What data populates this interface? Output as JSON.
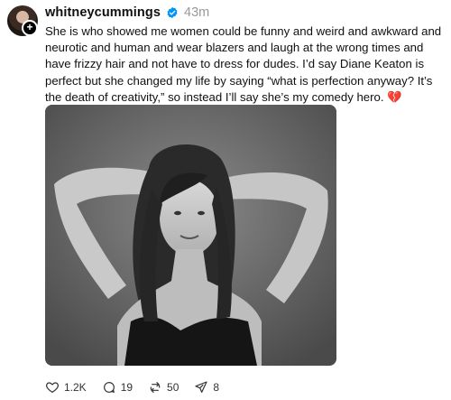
{
  "post": {
    "username": "whitneycummings",
    "timestamp": "43m",
    "text": "She is who showed me women could be funny and weird and awkward and neurotic and human and wear blazers and laugh at the wrong times and have frizzy hair and not have to dress for dudes. I’d say Diane Keaton is perfect but she changed my life by saying “what is perfection anyway? It’s the death of creativity,” so instead I’ll say she’s my comedy hero. 💔"
  },
  "actions": {
    "likes": "1.2K",
    "replies": "19",
    "reposts": "50",
    "shares": "8"
  },
  "icons": [
    "plus-icon",
    "verified-icon",
    "heart-icon",
    "comment-icon",
    "repost-icon",
    "share-icon"
  ],
  "colors": {
    "verified": "#0095f6",
    "timestamp": "#999999"
  }
}
